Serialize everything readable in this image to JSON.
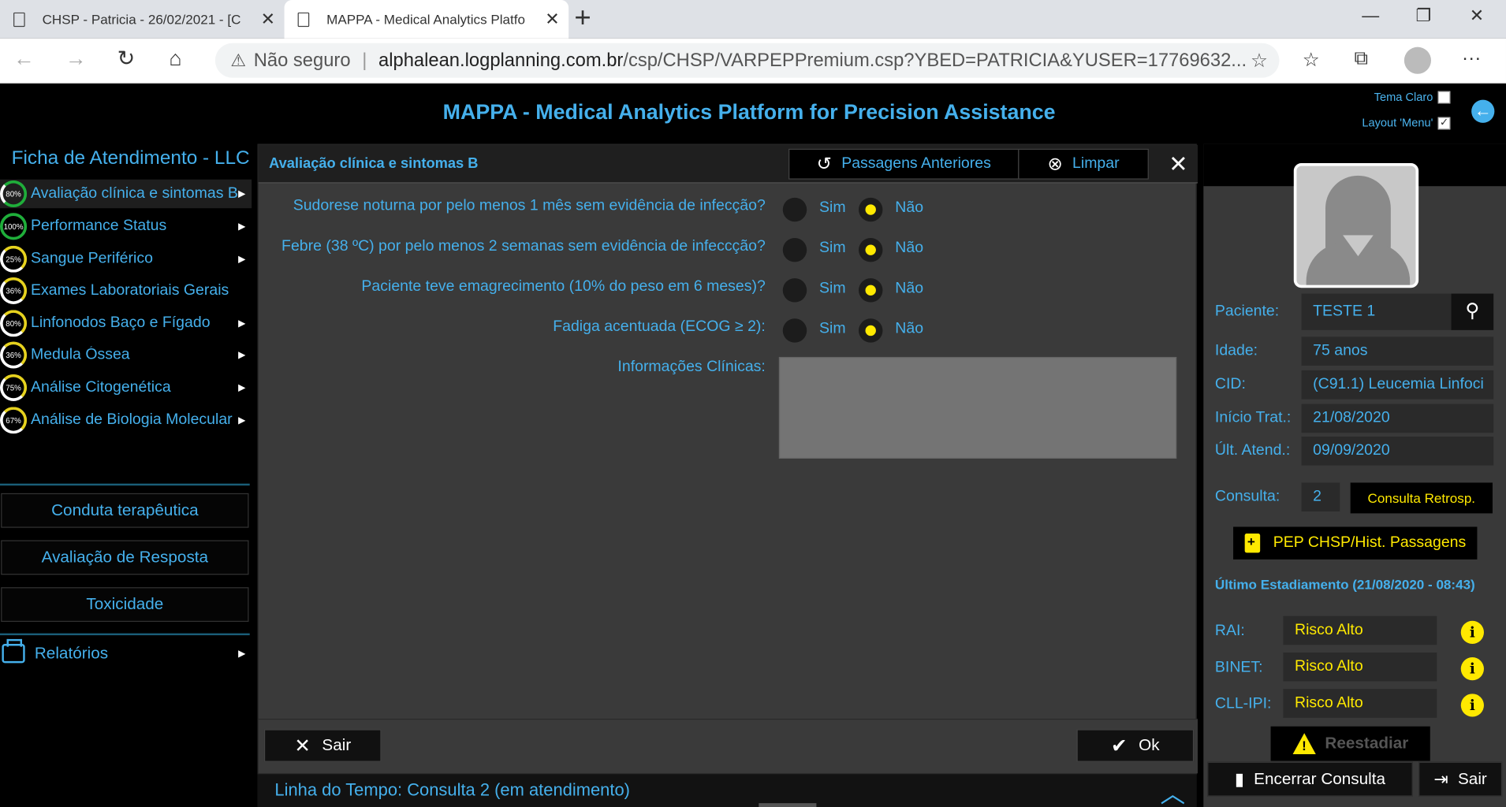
{
  "browser": {
    "tabs": [
      {
        "title": "CHSP - Patricia - 26/02/2021 - [C"
      },
      {
        "title": "MAPPA - Medical Analytics Platfo"
      }
    ],
    "security": "Não seguro",
    "url_domain": "alphalean.logplanning.com.br",
    "url_path": "/csp/CHSP/VARPEPPremium.csp?YBED=PATRICIA&YUSER=17769632..."
  },
  "header": {
    "title": "MAPPA - Medical Analytics Platform for Precision Assistance",
    "theme_label": "Tema Claro",
    "layout_label": "Layout 'Menu'",
    "theme_checked": false,
    "layout_checked": true
  },
  "sidebar": {
    "title": "Ficha de Atendimento - LLC",
    "items": [
      {
        "label": "Avaliação clínica e sintomas B",
        "progress": "80%",
        "active": true,
        "color": "green"
      },
      {
        "label": "Performance Status",
        "progress": "100%",
        "color": "green"
      },
      {
        "label": "Sangue Periférico",
        "progress": "25%",
        "color": "yellow"
      },
      {
        "label": "Exames Laboratoriais Gerais",
        "progress": "36%",
        "color": "yellow"
      },
      {
        "label": "Linfonodos Baço e Fígado",
        "progress": "80%",
        "color": "yellow"
      },
      {
        "label": "Medula Óssea",
        "progress": "36%",
        "color": "yellow"
      },
      {
        "label": "Análise Citogenética",
        "progress": "75%",
        "color": "yellow"
      },
      {
        "label": "Análise de Biologia Molecular",
        "progress": "67%",
        "color": "yellow"
      }
    ],
    "buttons": [
      "Conduta terapêutica",
      "Avaliação de Resposta",
      "Toxicidade"
    ],
    "reports": "Relatórios"
  },
  "panel": {
    "title": "Avaliação clínica e sintomas B",
    "btn_previous": "Passagens Anteriores",
    "btn_clear": "Limpar",
    "yes": "Sim",
    "no": "Não",
    "questions": [
      {
        "text": "Sudorese noturna por pelo menos 1 mês sem evidência de infecção?",
        "answer": "Não"
      },
      {
        "text": "Febre (38 ºC) por pelo menos 2 semanas sem evidência de infeccção?",
        "answer": "Não"
      },
      {
        "text": "Paciente teve emagrecimento (10% do peso em 6 meses)?",
        "answer": "Não"
      },
      {
        "text": "Fadiga acentuada (ECOG ≥  2):",
        "answer": "Não"
      }
    ],
    "info_label": "Informações Clínicas:",
    "btn_exit": "Sair",
    "btn_ok": "Ok"
  },
  "timeline": {
    "label": "Linha do Tempo: Consulta 2 (em atendimento)"
  },
  "patient": {
    "name_label": "Paciente:",
    "name": "TESTE 1",
    "age_label": "Idade:",
    "age": "75 anos",
    "cid_label": "CID:",
    "cid": "(C91.1) Leucemia Linfoci",
    "start_label": "Início Trat.:",
    "start": "21/08/2020",
    "last_label": "Últ. Atend.:",
    "last": "09/09/2020",
    "consult_label": "Consulta:",
    "consult": "2",
    "retro_btn": "Consulta Retrosp.",
    "pep_btn": "PEP CHSP/Hist. Passagens",
    "staging_title": "Último Estadiamento (21/08/2020 - 08:43)",
    "staging": [
      {
        "label": "RAI:",
        "value": "Risco Alto"
      },
      {
        "label": "BINET:",
        "value": "Risco Alto"
      },
      {
        "label": "CLL-IPI:",
        "value": "Risco Alto"
      }
    ],
    "restage_btn": "Reestadiar",
    "end_btn": "Encerrar Consulta",
    "exit_btn": "Sair"
  },
  "colors": {
    "accent": "#45b0ec",
    "highlight": "#ffe900",
    "panel_bg": "#3a3a3a"
  }
}
